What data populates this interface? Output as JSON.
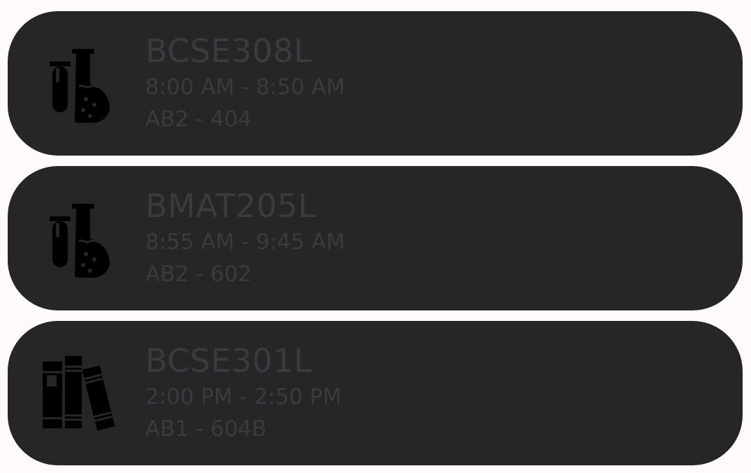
{
  "classes": [
    {
      "course": "BCSE308L",
      "time": "8:00 AM - 8:50 AM",
      "venue": "AB2 - 404",
      "icon": "flask-icon"
    },
    {
      "course": "BMAT205L",
      "time": "8:55 AM - 9:45 AM",
      "venue": "AB2 - 602",
      "icon": "flask-icon"
    },
    {
      "course": "BCSE301L",
      "time": "2:00 PM - 2:50 PM",
      "venue": "AB1 - 604B",
      "icon": "books-icon"
    }
  ],
  "colors": {
    "background": "#fdf9fc",
    "card": "#262626",
    "text": "#3a3a3f",
    "icon": "#000000"
  }
}
